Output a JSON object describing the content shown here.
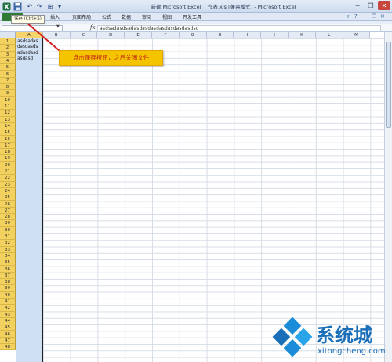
{
  "window": {
    "title": "新建 Microsoft Excel 工作表.xls [兼容模式] - Microsoft Excel"
  },
  "ribbon": {
    "tabs": [
      "插入",
      "页面布局",
      "公式",
      "数据",
      "审阅",
      "视图",
      "开发工具"
    ]
  },
  "tooltip": {
    "text": "保存 (Ctrl+S)"
  },
  "formula_bar": {
    "name_box": "",
    "fx": "fx",
    "value": "asdsadasdsadasdasdasdasdasdasdasdsd"
  },
  "sheet": {
    "columns": [
      "A",
      "B",
      "C",
      "D",
      "E",
      "F",
      "G",
      "H",
      "I",
      "J",
      "K",
      "L",
      "M"
    ],
    "selected_column": "A",
    "rows": [
      "1",
      "2",
      "3",
      "4",
      "5",
      "6",
      "7",
      "8",
      "9",
      "10",
      "11",
      "12",
      "13",
      "14",
      "15",
      "16",
      "17",
      "18",
      "19",
      "20",
      "21",
      "22",
      "23",
      "24",
      "25",
      "26",
      "27",
      "28",
      "29",
      "30",
      "31",
      "32",
      "33",
      "34",
      "35",
      "36",
      "37",
      "38",
      "39",
      "40",
      "41",
      "42",
      "43",
      "44",
      "45",
      "46",
      "47",
      "48"
    ],
    "cell_a1_lines": [
      "asdsadas",
      "dasdasds",
      "adasdasd",
      "asdasd"
    ]
  },
  "callout": {
    "text": "点击保存按钮，之后关闭文件"
  },
  "watermark": {
    "name": "系统城",
    "url": "xitongcheng.com"
  },
  "colors": {
    "row_header_highlight": "#f3d15e",
    "callout_bg": "#f5c400",
    "callout_text": "#c01818",
    "arrow": "#d42020",
    "watermark": "#1b6fb8"
  }
}
